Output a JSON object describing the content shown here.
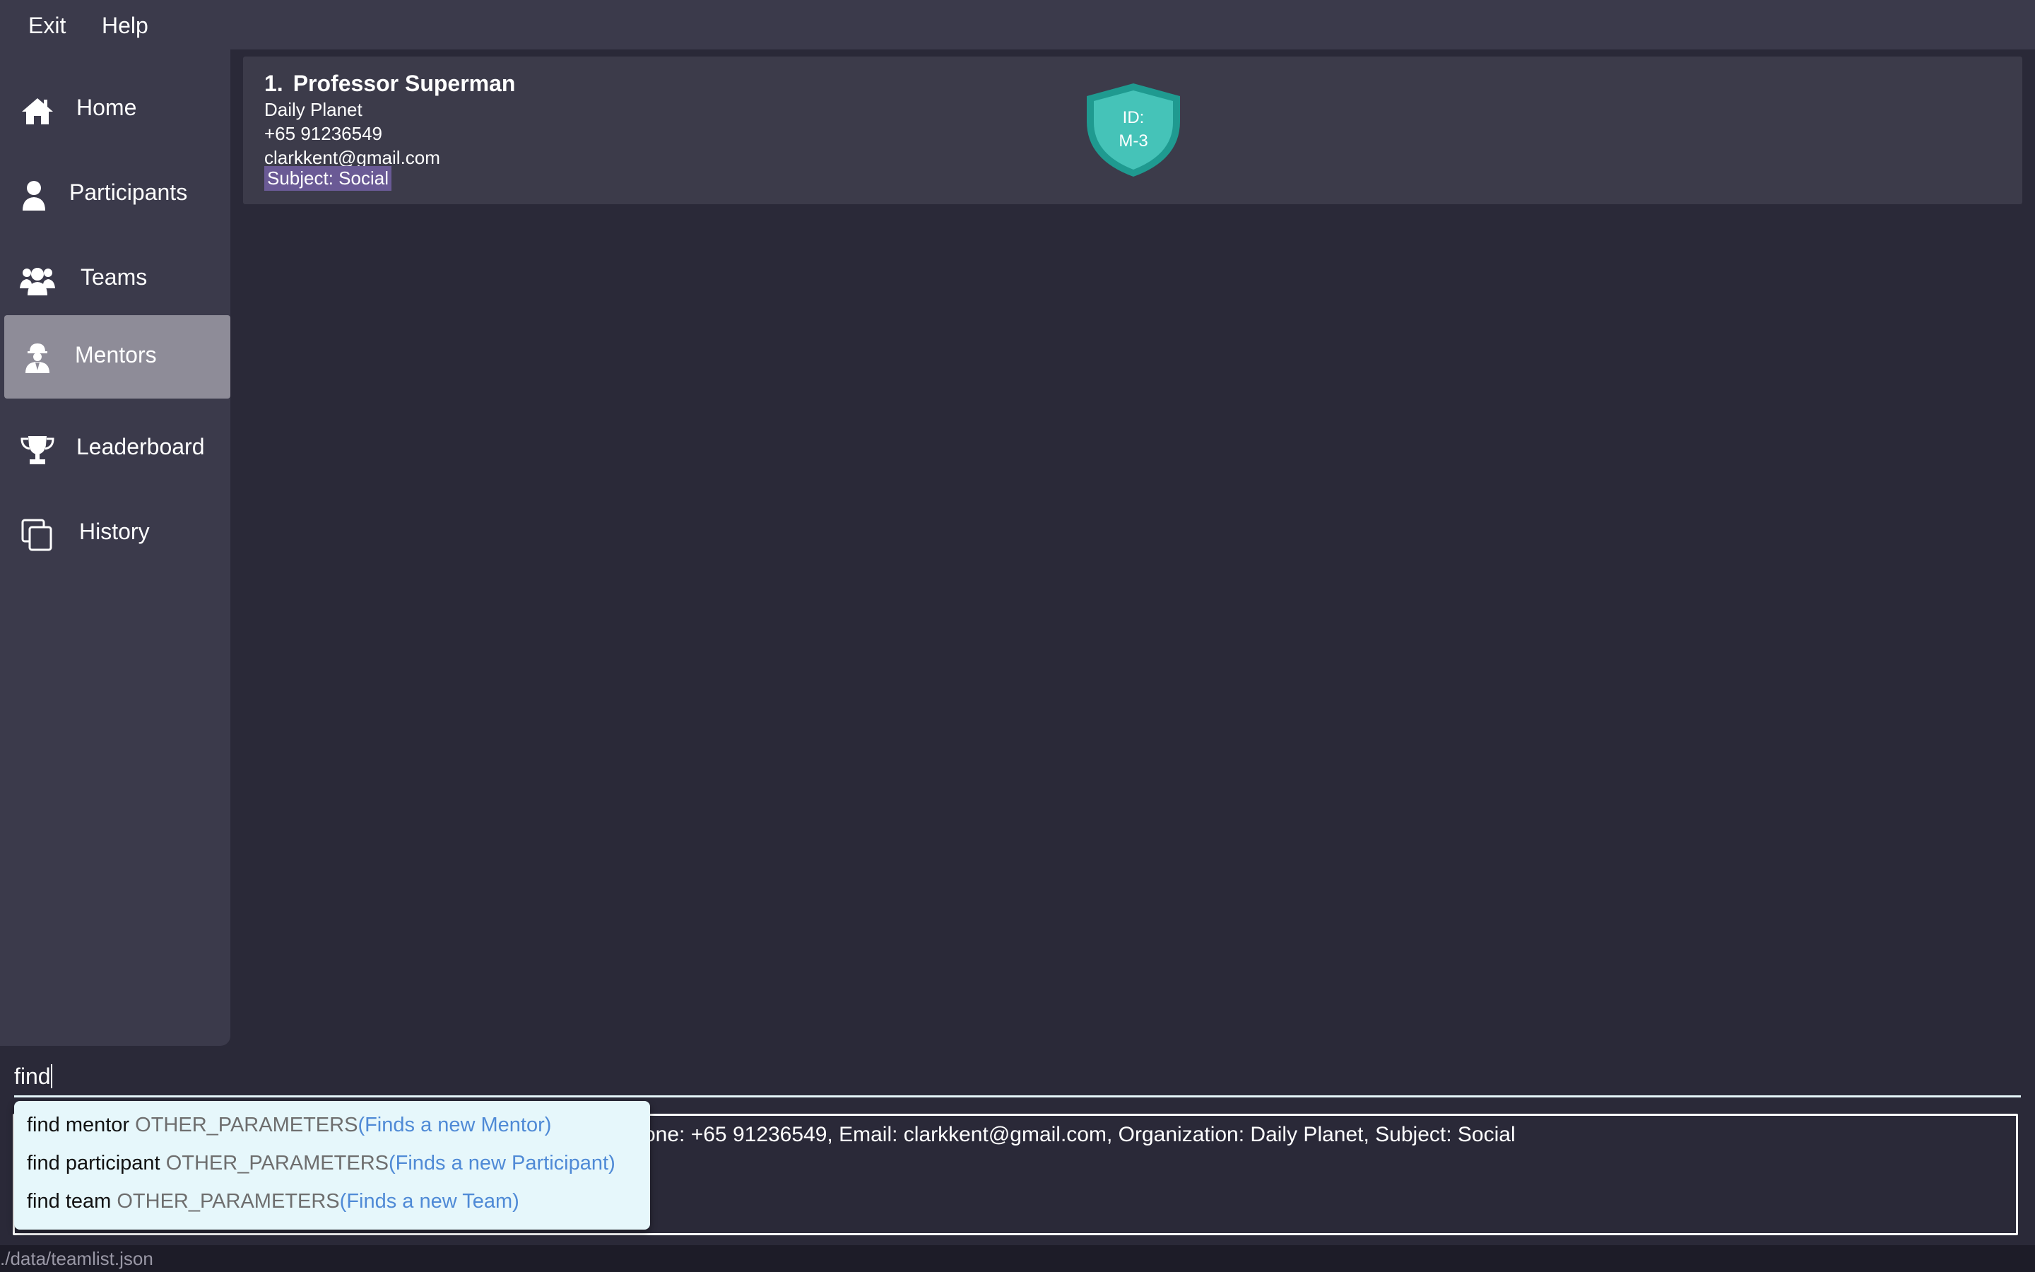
{
  "menu": {
    "exit": "Exit",
    "help": "Help"
  },
  "sidebar": {
    "items": [
      {
        "label": "Home",
        "icon": "home-icon"
      },
      {
        "label": "Participants",
        "icon": "person-icon"
      },
      {
        "label": "Teams",
        "icon": "group-icon"
      },
      {
        "label": "Mentors",
        "icon": "mentor-icon",
        "active": true
      },
      {
        "label": "Leaderboard",
        "icon": "trophy-icon"
      },
      {
        "label": "History",
        "icon": "copy-icon"
      }
    ]
  },
  "mentors": [
    {
      "index": "1.",
      "name": "Professor Superman",
      "organization": "Daily Planet",
      "phone": "+65 91236549",
      "email": "clarkkent@gmail.com",
      "subject": "Subject: Social",
      "id_label": "ID:",
      "id_value": "M-3"
    }
  ],
  "command": {
    "value": "find"
  },
  "result": {
    "text": "one: +65 91236549, Email: clarkkent@gmail.com, Organization: Daily Planet, Subject: Social"
  },
  "autocomplete": [
    {
      "command": "find mentor",
      "params": "OTHER_PARAMETERS",
      "description": "(Finds a new Mentor)"
    },
    {
      "command": "find participant",
      "params": "OTHER_PARAMETERS",
      "description": "(Finds a new Participant)"
    },
    {
      "command": "find team",
      "params": "OTHER_PARAMETERS",
      "description": "(Finds a new Team)"
    }
  ],
  "status": {
    "file_path": "./data/teamlist.json"
  },
  "colors": {
    "background": "#2a2938",
    "panel": "#3b3a4b",
    "active_nav": "#8e8c98",
    "shield": "#2fb3a8",
    "subject_tag": "#6a5a95",
    "popup": "#e6f7fb",
    "popup_desc": "#4f8ad6"
  }
}
